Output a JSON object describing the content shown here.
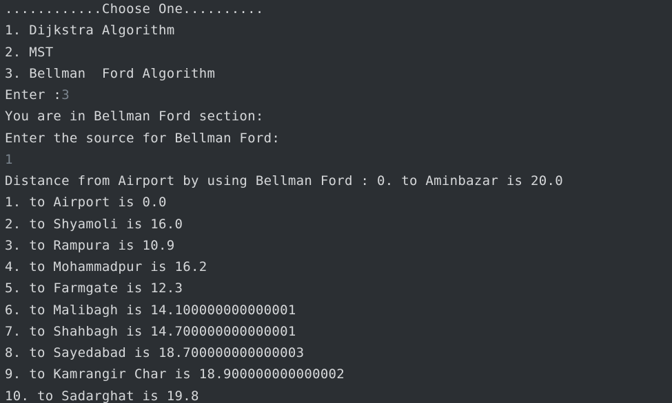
{
  "console": {
    "menu_header": "............Choose One..........",
    "menu_option_1": "1. Dijkstra Algorithm",
    "menu_option_2": "2. MST",
    "menu_option_3": "3. Bellman  Ford Algorithm",
    "enter_prompt": "Enter :",
    "enter_value": "3",
    "section_message": "You are in Bellman Ford section:",
    "source_prompt": "Enter the source for Bellman Ford:",
    "source_value": "1",
    "results": [
      "Distance from Airport by using Bellman Ford : 0. to Aminbazar is 20.0",
      "1. to Airport is 0.0",
      "2. to Shyamoli is 16.0",
      "3. to Rampura is 10.9",
      "4. to Mohammadpur is 16.2",
      "5. to Farmgate is 12.3",
      "6. to Malibagh is 14.100000000000001",
      "7. to Shahbagh is 14.700000000000001",
      "8. to Sayedabad is 18.700000000000003",
      "9. to Kamrangir Char is 18.900000000000002",
      "10. to Sadarghat is 19.8"
    ]
  },
  "colors": {
    "background": "#2b2f33",
    "output_text": "#d6d8da",
    "user_input_text": "#7b858f"
  }
}
